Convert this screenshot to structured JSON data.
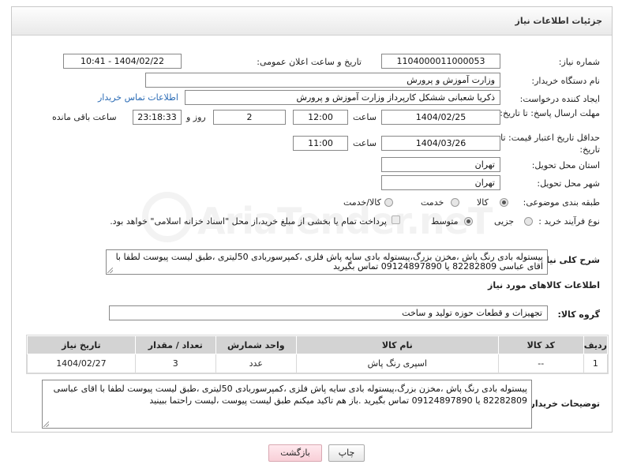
{
  "header": {
    "title": "جزئیات اطلاعات نیاز"
  },
  "fields": {
    "need_number_label": "شماره نیاز:",
    "need_number": "1104000011000053",
    "announce_label": "تاریخ و ساعت اعلان عمومی:",
    "announce_value": "1404/02/22 - 10:41",
    "buyer_org_label": "نام دستگاه خریدار:",
    "buyer_org": "وزارت آموزش و پرورش",
    "creator_label": "ایجاد کننده درخواست:",
    "creator": "ذکریا شعبانی ششکل کارپرداز وزارت آموزش و پرورش",
    "buyer_contact_link": "اطلاعات تماس خریدار",
    "reply_deadline_label": "مهلت ارسال پاسخ: تا تاریخ:",
    "reply_date": "1404/02/25",
    "time_label": "ساعت",
    "reply_time": "12:00",
    "days_value": "2",
    "days_label": "روز و",
    "remaining_time": "23:18:33",
    "remaining_label": "ساعت باقی مانده",
    "price_validity_label": "حداقل تاریخ اعتبار قیمت: تا تاریخ:",
    "validity_date": "1404/03/26",
    "validity_time": "11:00",
    "province_label": "استان محل تحویل:",
    "province": "تهران",
    "city_label": "شهر محل تحویل:",
    "city": "تهران",
    "category_label": "طبقه بندی موضوعی:",
    "category_options": [
      "کالا",
      "خدمت",
      "کالا/خدمت"
    ],
    "purchase_type_label": "نوع فرآیند خرید :",
    "purchase_options": [
      "جزیی",
      "متوسط"
    ],
    "payment_note": "پرداخت تمام یا بخشی از مبلغ خرید،از محل \"اسناد خزانه اسلامی\" خواهد بود.",
    "description_label": "شرح کلی نیاز:",
    "description": "پیستوله بادی رنگ پاش ،مخزن بزرگ،پیستوله بادی سایه پاش فلزی ،کمپرسوربادی 50لیتری ،طبق لیست پیوست لطفا با اقای عباسی 82282809 یا 09124897890 تماس بگیرید"
  },
  "goods": {
    "section_title": "اطلاعات کالاهای مورد نیاز",
    "group_label": "گروه کالا:",
    "group_value": "تجهیزات و قطعات حوزه تولید و ساخت",
    "columns": [
      "ردیف",
      "کد کالا",
      "نام کالا",
      "واحد شمارش",
      "تعداد / مقدار",
      "تاریخ نیاز"
    ],
    "rows": [
      {
        "row": "1",
        "code": "--",
        "name": "اسپری رنگ پاش",
        "unit": "عدد",
        "qty": "3",
        "date": "1404/02/27"
      }
    ]
  },
  "buyer_notes": {
    "label": "توضیحات خریدار:",
    "text": "پیستوله بادی رنگ پاش ،مخزن بزرگ،پیستوله بادی سایه پاش فلزی ،کمپرسوربادی 50لیتری ،طبق لیست پیوست لطفا با اقای عباسی 82282809 یا 09124897890 تماس بگیرید .باز هم تاکید میکنم طبق لیست پیوست ،لیست راحتما ببینید"
  },
  "buttons": {
    "print": "چاپ",
    "back": "بازگشت"
  },
  "watermark": {
    "text": "AriaTender.neT"
  },
  "colors": {
    "link": "#2a6bb5",
    "header_bg": "#e9e9e9",
    "table_head": "#d3d3d3",
    "back_button": "#f8cfd7"
  }
}
